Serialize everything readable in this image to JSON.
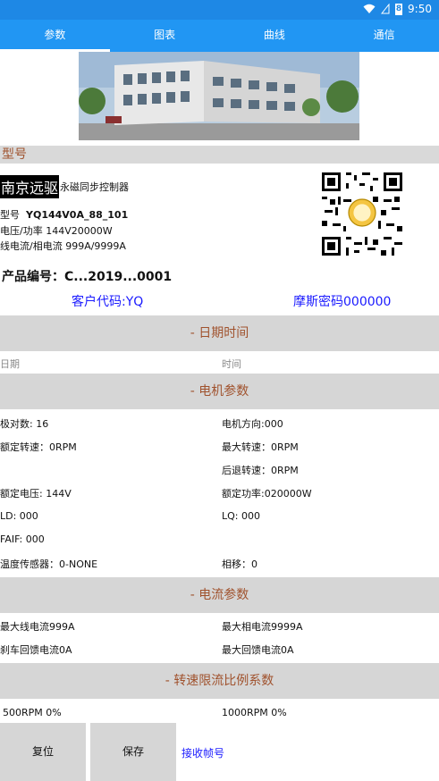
{
  "status": {
    "time": "9:50",
    "battery": "8"
  },
  "tabs": [
    "参数",
    "图表",
    "曲线",
    "通信"
  ],
  "model_section": "型号",
  "brand": {
    "name": "南京远驱",
    "desc": "永磁同步控制器"
  },
  "specs": {
    "model_label": "型号",
    "model_value": "YQ144V0A_88_101",
    "voltage_power": "电压/功率  144V20000W",
    "current": "线电流/相电流  999A/9999A"
  },
  "product_no": "产品编号：C...2019...0001",
  "customer_code": "客户代码:YQ",
  "morse_code": "摩斯密码000000",
  "sections": {
    "datetime": "- 日期时间",
    "motor": "- 电机参数",
    "current": "- 电流参数",
    "speed": "- 转速限流比例系数"
  },
  "datetime": {
    "date": "日期",
    "time": "时间"
  },
  "motor_params": {
    "pole_pairs": "极对数: 16",
    "direction": "电机方向:000",
    "rated_speed": "额定转速：0RPM",
    "max_speed": "最大转速：0RPM",
    "reverse_speed": "后退转速：0RPM",
    "rated_voltage": "额定电压: 144V",
    "rated_power": "额定功率:020000W",
    "ld": "LD: 000",
    "lq": "LQ: 000",
    "faif": "FAIF: 000",
    "temp_sensor": "温度传感器：0-NONE",
    "phase_shift": "相移：0"
  },
  "current_params": {
    "max_line": "最大线电流999A",
    "max_phase": "最大相电流9999A",
    "brake": "刹车回馈电流0A",
    "max_feedback": "最大回馈电流0A"
  },
  "speed_params": {
    "rpm500": "500RPM   0%",
    "rpm1000": "1000RPM   0%"
  },
  "buttons": {
    "reset": "复位",
    "save": "保存",
    "receive": "接收帧号"
  },
  "colors": {
    "tab_blue": "#2196f3",
    "section_text": "#a0522d",
    "link_blue": "#1a1aff"
  }
}
